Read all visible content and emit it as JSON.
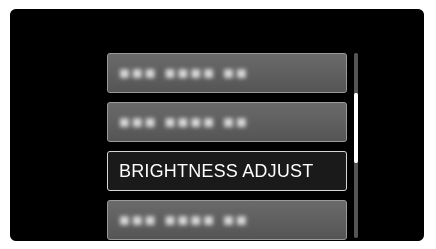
{
  "menu": {
    "items": [
      {
        "label": "■■■ ■■■■ ■■",
        "state": "unreadable"
      },
      {
        "label": "■■■ ■■■■ ■■",
        "state": "unreadable"
      },
      {
        "label": "BRIGHTNESS ADJUST",
        "state": "selected"
      },
      {
        "label": "■■■ ■■■■ ■■",
        "state": "unreadable"
      }
    ]
  },
  "colors": {
    "screen_bg": "#000000",
    "item_bg": "#5f5f5f",
    "selected_bg": "#1a1a1a",
    "selected_border": "#d6d6d6",
    "text": "#ffffff"
  }
}
